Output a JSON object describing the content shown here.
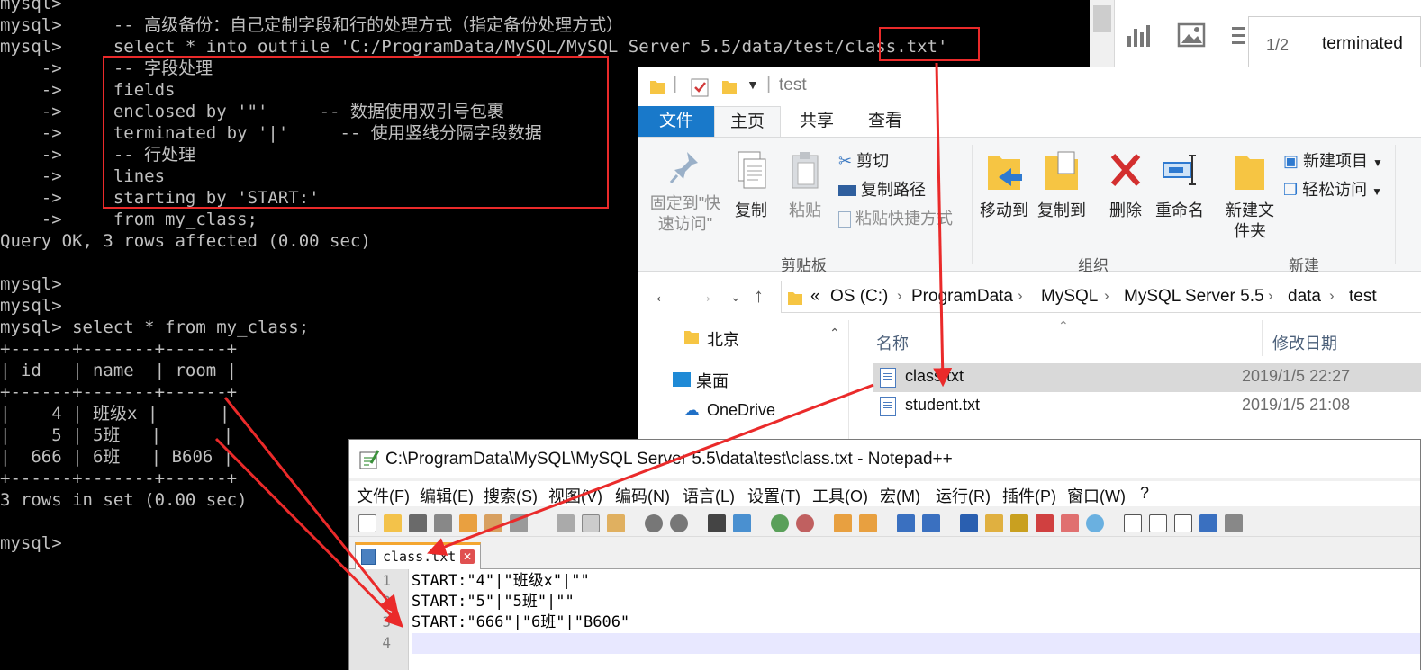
{
  "console": {
    "lines": [
      "mysql>",
      "mysql>     -- 高级备份：自己定制字段和行的处理方式（指定备份处理方式）",
      "mysql>     select * into outfile 'C:/ProgramData/MySQL/MySQL Server 5.5/data/test/class.txt'",
      "    ->     -- 字段处理",
      "    ->     fields",
      "    ->     enclosed by '\"'     -- 数据使用双引号包裹",
      "    ->     terminated by '|'     -- 使用竖线分隔字段数据",
      "    ->     -- 行处理",
      "    ->     lines",
      "    ->     starting by 'START:'",
      "    ->     from my_class;",
      "Query OK, 3 rows affected (0.00 sec)",
      "",
      "mysql>",
      "mysql>",
      "mysql> select * from my_class;",
      "+------+-------+------+",
      "| id   | name  | room |",
      "+------+-------+------+",
      "|    4 | 班级x |      |",
      "|    5 | 5班   |      |",
      "|  666 | 6班   | B606 |",
      "+------+-------+------+",
      "3 rows in set (0.00 sec)",
      "",
      "mysql>"
    ]
  },
  "strip": {
    "page": "1/2",
    "term": "terminated",
    "icons": [
      "bar-chart-icon",
      "picture-icon",
      "list-icon"
    ]
  },
  "explorer": {
    "title": "test",
    "tabs": [
      "文件",
      "主页",
      "共享",
      "查看"
    ],
    "clipboard": {
      "pin": "固定到\"快速访问\"",
      "copy": "复制",
      "paste": "粘贴",
      "cut": "剪切",
      "copy_path": "复制路径",
      "paste_shortcut": "粘贴快捷方式",
      "group": "剪贴板"
    },
    "organize": {
      "move_to": "移动到",
      "copy_to": "复制到",
      "delete": "删除",
      "rename": "重命名",
      "group": "组织"
    },
    "new": {
      "new_folder": "新建文件夹",
      "new_item": "新建项目",
      "easy_access": "轻松访问",
      "group": "新建"
    },
    "path": [
      "«",
      "OS (C:)",
      "ProgramData",
      "MySQL",
      "MySQL Server 5.5",
      "data",
      "test"
    ],
    "nav_items": [
      "北京",
      "桌面",
      "OneDrive"
    ],
    "col_name": "名称",
    "col_date": "修改日期",
    "files": [
      {
        "name": "class.txt",
        "date": "2019/1/5 22:27",
        "selected": true
      },
      {
        "name": "student.txt",
        "date": "2019/1/5 21:08",
        "selected": false
      }
    ]
  },
  "npp": {
    "title": "C:\\ProgramData\\MySQL\\MySQL Server 5.5\\data\\test\\class.txt - Notepad++",
    "menu": [
      "文件(F)",
      "编辑(E)",
      "搜索(S)",
      "视图(V)",
      "编码(N)",
      "语言(L)",
      "设置(T)",
      "工具(O)",
      "宏(M)",
      "运行(R)",
      "插件(P)",
      "窗口(W)",
      "?"
    ],
    "tab": "class.txt",
    "lines": [
      {
        "num": "1",
        "text": "START:\"4\"|\"班级x\"|\"\""
      },
      {
        "num": "2",
        "text": "START:\"5\"|\"5班\"|\"\""
      },
      {
        "num": "3",
        "text": "START:\"666\"|\"6班\"|\"B606\""
      },
      {
        "num": "4",
        "text": ""
      }
    ]
  },
  "colors": {
    "accent": "#1979ca",
    "annotation": "#ea2a2a",
    "console_text": "#c0c0c0"
  }
}
